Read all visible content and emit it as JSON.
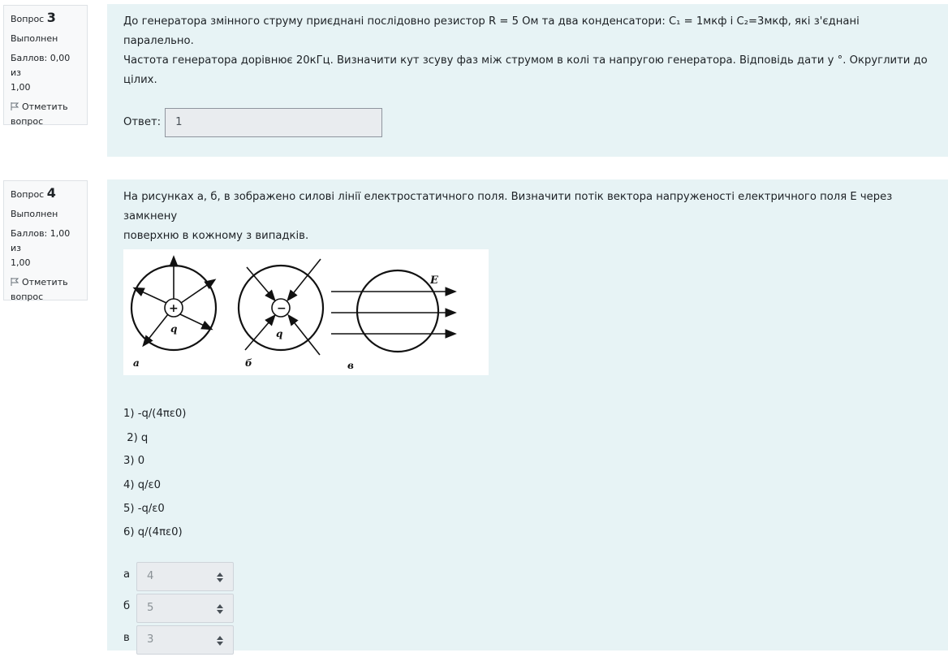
{
  "q3": {
    "info": {
      "label": "Вопрос",
      "number": "3",
      "state": "Выполнен",
      "grade_line1": "Баллов: 0,00 из",
      "grade_line2": "1,00",
      "flag_line1": "Отметить",
      "flag_line2": "вопрос"
    },
    "text_line1": "До генератора змінного струму приєднані послідовно резистор R = 5 Ом  та два конденсатори: C₁  = 1мкф і  C₂=3мкф, які з'єднані паралельно.",
    "text_line2": " Частота генератора дорівнює 20кГц. Визначити кут зсуву фаз між струмом в колі та напругою  генератора.  Відповідь дати у °.  Округлити до",
    "text_line3": "цілих.",
    "answer_label": "Ответ:",
    "answer_value": "1"
  },
  "q4": {
    "info": {
      "label": "Вопрос",
      "number": "4",
      "state": "Выполнен",
      "grade_line1": "Баллов: 1,00 из",
      "grade_line2": "1,00",
      "flag_line1": "Отметить",
      "flag_line2": "вопрос"
    },
    "text_line1": "На рисунках а, б, в зображено силові лінії електростатичного поля. Визначити потік вектора напруженості електричного поля  E через замкнену",
    "text_line2": "поверхню в кожному з випадків.",
    "figure": {
      "label_a": "а",
      "label_b": "б",
      "label_c": "в",
      "q_a": "q",
      "q_b": "q",
      "e_label": "E",
      "plus": "+",
      "minus": "−"
    },
    "options": [
      "1) -q/(4πε0)",
      " 2) q",
      "3) 0",
      "4) q/ε0",
      "5) -q/ε0",
      "6) q/(4πε0)"
    ],
    "selects": [
      {
        "label": "а",
        "value": "4"
      },
      {
        "label": "б",
        "value": "5"
      },
      {
        "label": "в",
        "value": "3"
      }
    ]
  }
}
